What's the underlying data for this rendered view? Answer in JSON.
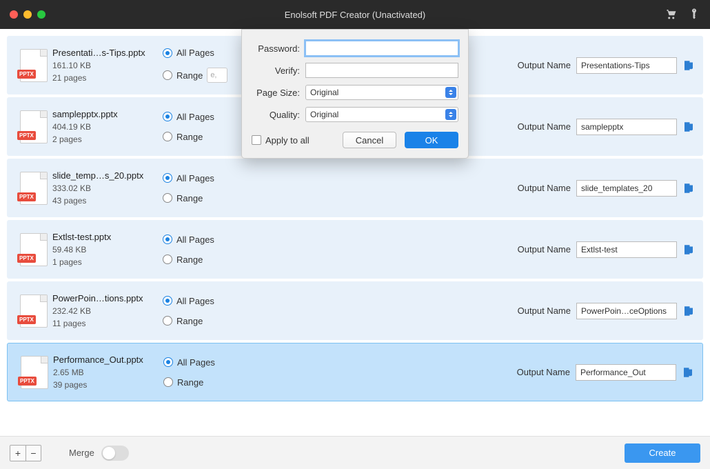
{
  "window": {
    "title": "Enolsoft PDF Creator (Unactivated)"
  },
  "file_badge": "PPTX",
  "labels": {
    "all_pages": "All Pages",
    "range": "Range",
    "range_placeholder": "e,",
    "output_name": "Output Name",
    "merge": "Merge",
    "create": "Create"
  },
  "modal": {
    "password_label": "Password:",
    "verify_label": "Verify:",
    "pagesize_label": "Page Size:",
    "quality_label": "Quality:",
    "pagesize_value": "Original",
    "quality_value": "Original",
    "apply_label": "Apply to all",
    "cancel": "Cancel",
    "ok": "OK"
  },
  "files": [
    {
      "name": "Presentati…s-Tips.pptx",
      "size": "161.10 KB",
      "pages": "21 pages",
      "output": "Presentations-Tips",
      "range_shown": true
    },
    {
      "name": "samplepptx.pptx",
      "size": "404.19 KB",
      "pages": "2 pages",
      "output": "samplepptx",
      "range_shown": false
    },
    {
      "name": "slide_temp…s_20.pptx",
      "size": "333.02 KB",
      "pages": "43 pages",
      "output": "slide_templates_20",
      "range_shown": false
    },
    {
      "name": "Extlst-test.pptx",
      "size": "59.48 KB",
      "pages": "1 pages",
      "output": "Extlst-test",
      "range_shown": false
    },
    {
      "name": "PowerPoin…tions.pptx",
      "size": "232.42 KB",
      "pages": "11 pages",
      "output": "PowerPoin…ceOptions",
      "range_shown": false
    },
    {
      "name": "Performance_Out.pptx",
      "size": "2.65 MB",
      "pages": "39 pages",
      "output": "Performance_Out",
      "range_shown": false,
      "selected": true
    }
  ]
}
